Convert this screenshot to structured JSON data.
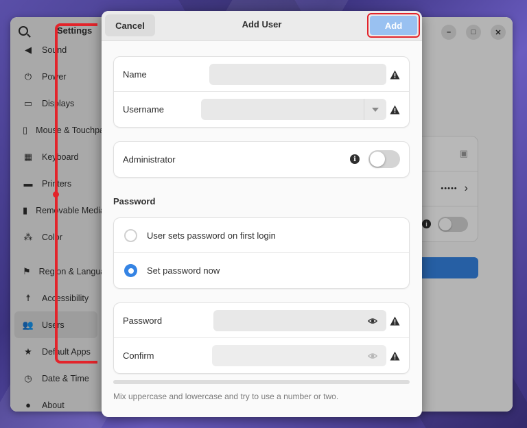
{
  "settings": {
    "sidebar_title": "Settings",
    "sidebar_items": [
      {
        "label": "Sound",
        "icon": "speaker-icon"
      },
      {
        "label": "Power",
        "icon": "power-icon"
      },
      {
        "label": "Displays",
        "icon": "display-icon"
      },
      {
        "label": "Mouse & Touchpad",
        "icon": "mouse-icon"
      },
      {
        "label": "Keyboard",
        "icon": "keyboard-icon"
      },
      {
        "label": "Printers",
        "icon": "printer-icon"
      },
      {
        "label": "Removable Media",
        "icon": "usb-icon"
      },
      {
        "label": "Color",
        "icon": "palette-icon"
      },
      {
        "label": "Region & Language",
        "icon": "flag-icon"
      },
      {
        "label": "Accessibility",
        "icon": "accessibility-icon"
      },
      {
        "label": "Users",
        "icon": "users-icon",
        "selected": true
      },
      {
        "label": "Default Apps",
        "icon": "star-icon"
      },
      {
        "label": "Date & Time",
        "icon": "clock-icon"
      },
      {
        "label": "About",
        "icon": "info-icon"
      }
    ],
    "background_password_dots": "•••••"
  },
  "dialog": {
    "title": "Add User",
    "cancel_label": "Cancel",
    "add_label": "Add",
    "name_label": "Name",
    "name_value": "",
    "username_label": "Username",
    "username_value": "",
    "administrator_label": "Administrator",
    "administrator_enabled": false,
    "password_heading": "Password",
    "password_options": [
      {
        "label": "User sets password on first login",
        "selected": false
      },
      {
        "label": "Set password now",
        "selected": true
      }
    ],
    "password_label": "Password",
    "password_value": "",
    "confirm_label": "Confirm",
    "confirm_value": "",
    "password_strength": 0,
    "hint": "Mix uppercase and lowercase and try to use a number or two."
  },
  "colors": {
    "accent": "#3584e4",
    "add_button": "#99c1f1",
    "annotation": "#e3242b"
  }
}
